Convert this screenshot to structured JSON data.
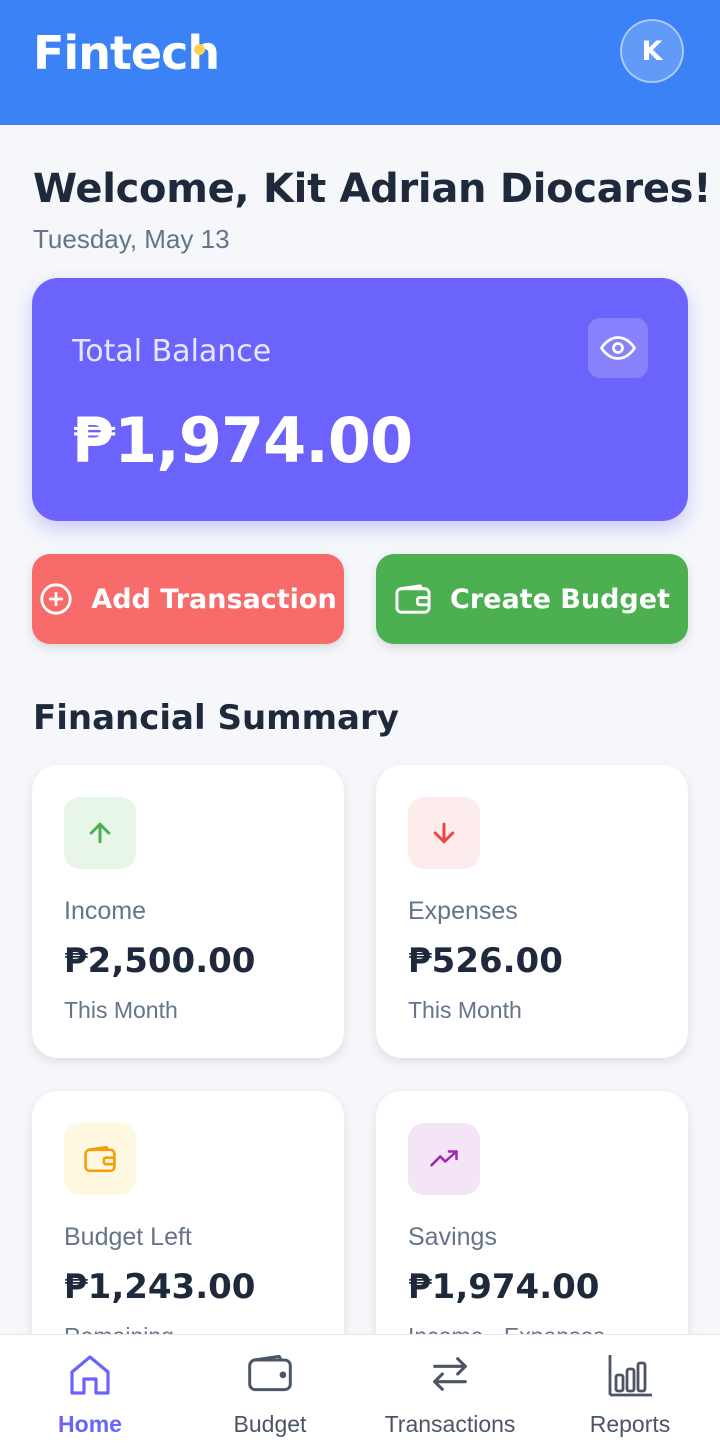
{
  "header": {
    "app_name": "Fintech",
    "avatar_initial": "K"
  },
  "welcome": {
    "title": "Welcome, Kit Adrian Diocares!",
    "date": "Tuesday, May 13"
  },
  "balance": {
    "label": "Total Balance",
    "amount": "₱1,974.00"
  },
  "actions": {
    "add_label": "Add Transaction",
    "budget_label": "Create Budget"
  },
  "summary": {
    "title": "Financial Summary",
    "cards": [
      {
        "label": "Income",
        "value": "₱2,500.00",
        "sub": "This Month",
        "icon": "arrow-up-icon",
        "color": "#4caf50"
      },
      {
        "label": "Expenses",
        "value": "₱526.00",
        "sub": "This Month",
        "icon": "arrow-down-icon",
        "color": "#ef4444"
      },
      {
        "label": "Budget Left",
        "value": "₱1,243.00",
        "sub": "Remaining",
        "icon": "wallet-icon",
        "color": "#f59e0b"
      },
      {
        "label": "Savings",
        "value": "₱1,974.00",
        "sub": "Income - Expenses",
        "icon": "trending-up-icon",
        "color": "#9c27b0"
      }
    ]
  },
  "nav": [
    {
      "label": "Home",
      "icon": "home-icon",
      "active": true
    },
    {
      "label": "Budget",
      "icon": "wallet-icon"
    },
    {
      "label": "Transactions",
      "icon": "swap-icon"
    },
    {
      "label": "Reports",
      "icon": "bar-chart-icon"
    }
  ],
  "colors": {
    "primary": "#3b82f6",
    "accent": "#6b63fc",
    "danger": "#f76b6b",
    "success": "#4caf50"
  }
}
